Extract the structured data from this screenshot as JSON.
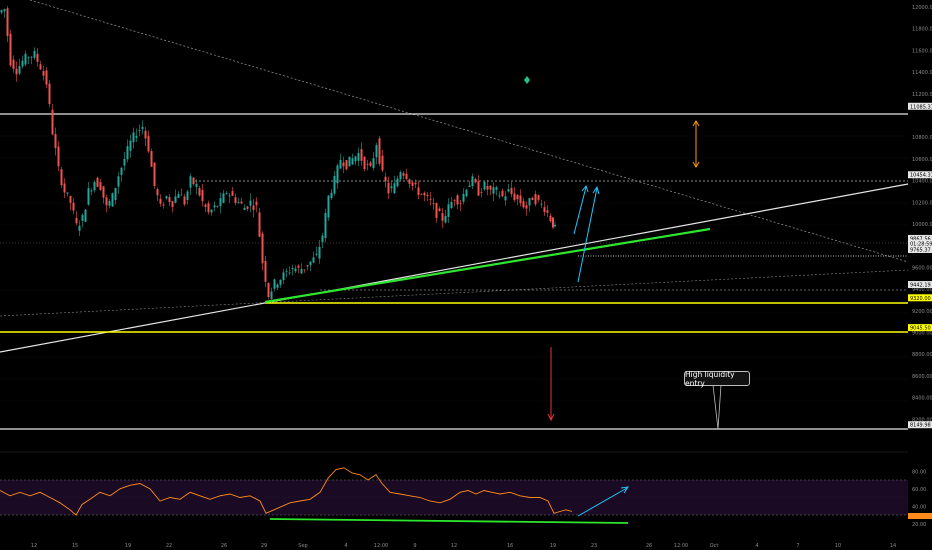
{
  "chart_data": {
    "type": "candlestick",
    "price_axis": {
      "ticks": [
        "12000.00",
        "11800.00",
        "11600.00",
        "11400.00",
        "11200.00",
        "10800.00",
        "10600.00",
        "10400.00",
        "10200.00",
        "10000.00",
        "9600.00",
        "9400.00",
        "9200.00",
        "9000.00",
        "8800.00",
        "8600.00",
        "8400.00",
        "8200.00"
      ],
      "range": [
        8150,
        12100
      ]
    },
    "time_axis": {
      "ticks": [
        "12",
        "15",
        "19",
        "22",
        "26",
        "29",
        "Sep",
        "4",
        "12:00",
        "9",
        "12",
        "16",
        "19",
        "23",
        "26",
        "12:00",
        "Oct",
        "4",
        "7",
        "10",
        "14"
      ]
    },
    "price_tags": [
      {
        "text": "11085.37",
        "price": 11085,
        "style": "white"
      },
      {
        "text": "10454.31",
        "price": 10454,
        "style": "white"
      },
      {
        "text": "9867.56",
        "price": 9867,
        "style": "white"
      },
      {
        "text": "01:28:59",
        "price": 9822,
        "style": "white"
      },
      {
        "text": "9765.37",
        "price": 9765,
        "style": "white"
      },
      {
        "text": "9442.19",
        "price": 9442,
        "style": "white"
      },
      {
        "text": "9320.00",
        "price": 9320,
        "style": "yellow"
      },
      {
        "text": "9045.50",
        "price": 9045,
        "style": "yellow"
      },
      {
        "text": "8149.98",
        "price": 8150,
        "style": "white"
      }
    ],
    "annotations": {
      "callout": "High liquidity entry"
    },
    "rsi": {
      "ticks": [
        "80.00",
        "60.00",
        "40.00",
        "20.00"
      ],
      "range": [
        12,
        92
      ]
    },
    "colors": {
      "up": "#26a69a",
      "down": "#ef5350",
      "green_line": "#2ee62e",
      "yellow_line": "#ffff00",
      "cyan": "#1ec8ff",
      "orange": "#ff9800",
      "red_arrow": "#e53935",
      "rsi_line": "#ff8c1a",
      "rsi_band": "#1a0a24"
    }
  }
}
